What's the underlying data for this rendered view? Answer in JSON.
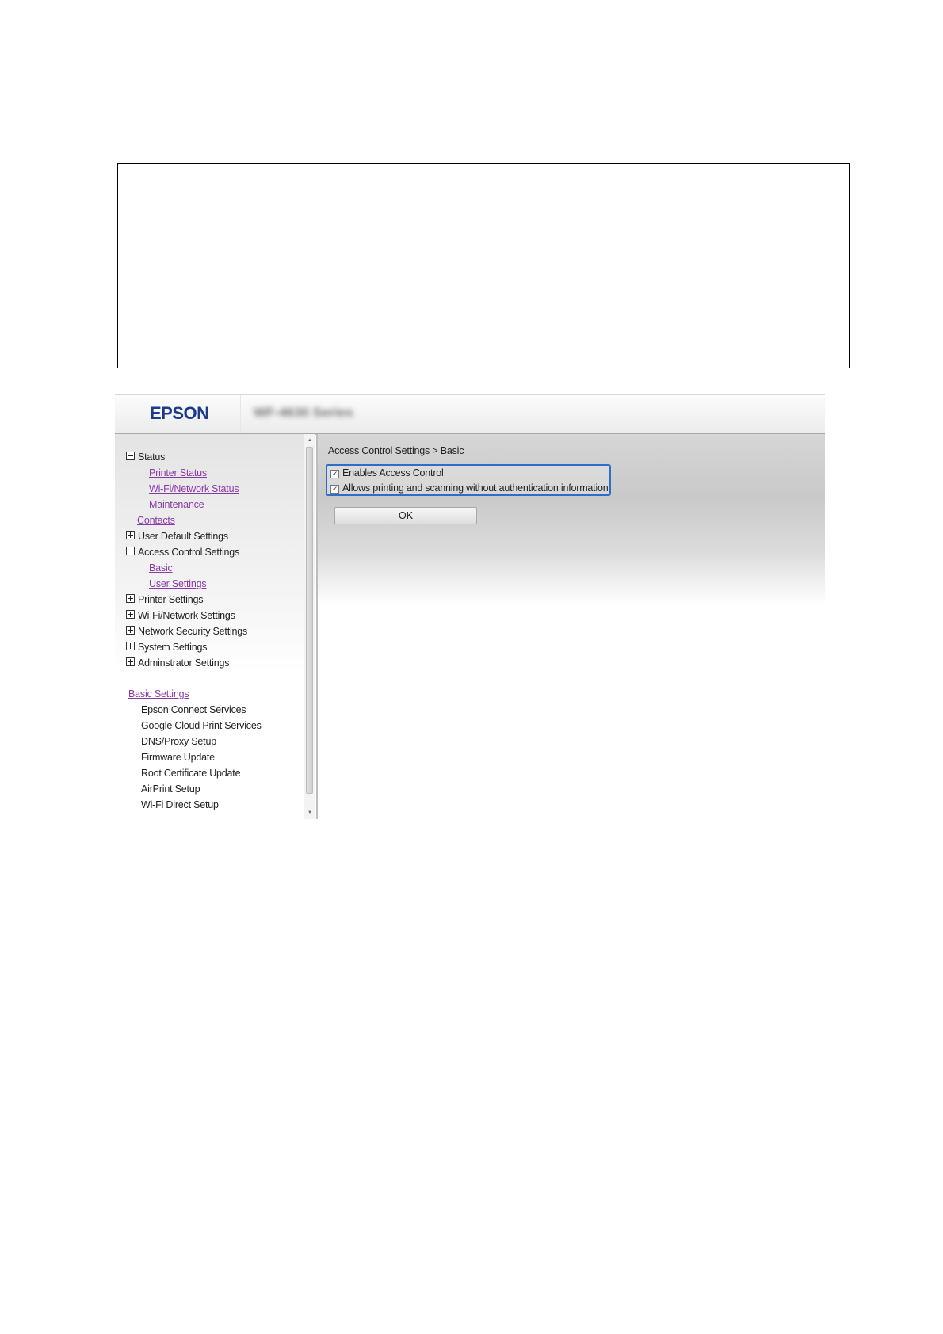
{
  "header": {
    "logo_text": "EPSON",
    "model_name": "WF-4630 Series"
  },
  "sidebar": {
    "status": "Status",
    "printer_status": "Printer Status",
    "wifi_network_status": "Wi-Fi/Network Status",
    "maintenance": "Maintenance",
    "contacts": "Contacts",
    "user_default_settings": "User Default Settings",
    "access_control_settings": "Access Control Settings",
    "basic": "Basic",
    "user_settings": "User Settings",
    "printer_settings": "Printer Settings",
    "wifi_network_settings": "Wi-Fi/Network Settings",
    "network_security_settings": "Network Security Settings",
    "system_settings": "System Settings",
    "administrator_settings": "Adminstrator Settings",
    "basic_settings": "Basic Settings",
    "epson_connect_services": "Epson Connect Services",
    "google_cloud_print_services": "Google Cloud Print Services",
    "dns_proxy_setup": "DNS/Proxy Setup",
    "firmware_update": "Firmware Update",
    "root_certificate_update": "Root Certificate Update",
    "airprint_setup": "AirPrint Setup",
    "wifi_direct_setup": "Wi-Fi Direct Setup"
  },
  "main": {
    "breadcrumb": "Access Control Settings > Basic",
    "options": [
      {
        "label": "Enables Access Control",
        "checked": true
      },
      {
        "label": "Allows printing and scanning without authentication information",
        "checked": true
      }
    ],
    "checkmark": "✓",
    "ok_label": "OK"
  },
  "colors": {
    "logo": "#1d3b8e",
    "link": "#8a3aa8",
    "focus_border": "#2b6fc9"
  }
}
